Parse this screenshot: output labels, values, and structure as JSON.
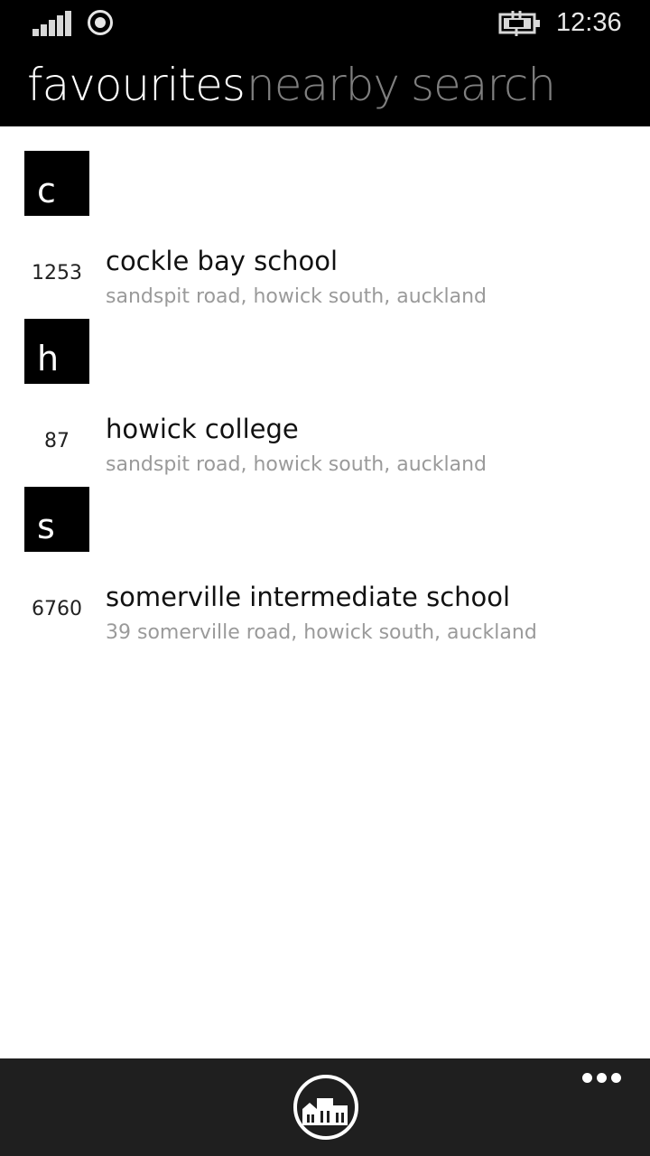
{
  "status_bar": {
    "time": "12:36",
    "signal_icon": "signal-bars-icon",
    "wifi_icon": "location-ring-icon",
    "battery_icon": "battery-charging-icon"
  },
  "pivot": {
    "tabs": [
      {
        "label": "favourites",
        "active": true
      },
      {
        "label": "nearby",
        "active": false
      },
      {
        "label": "search",
        "active": false
      }
    ]
  },
  "groups": [
    {
      "letter": "c",
      "items": [
        {
          "number": "1253",
          "title": "cockle bay school",
          "address": "sandspit road, howick south, auckland"
        }
      ]
    },
    {
      "letter": "h",
      "items": [
        {
          "number": "87",
          "title": "howick college",
          "address": "sandspit road, howick south, auckland"
        }
      ]
    },
    {
      "letter": "s",
      "items": [
        {
          "number": "6760",
          "title": "somerville intermediate school",
          "address": "39 somerville road, howick south, auckland"
        }
      ]
    }
  ],
  "app_bar": {
    "primary_icon": "school-buildings-icon",
    "more_icon": "more-dots-icon"
  },
  "colors": {
    "header_bg": "#000000",
    "tab_active": "#ffffff",
    "tab_inactive": "#7f7f7f",
    "app_bar_bg": "#1f1f1f"
  }
}
